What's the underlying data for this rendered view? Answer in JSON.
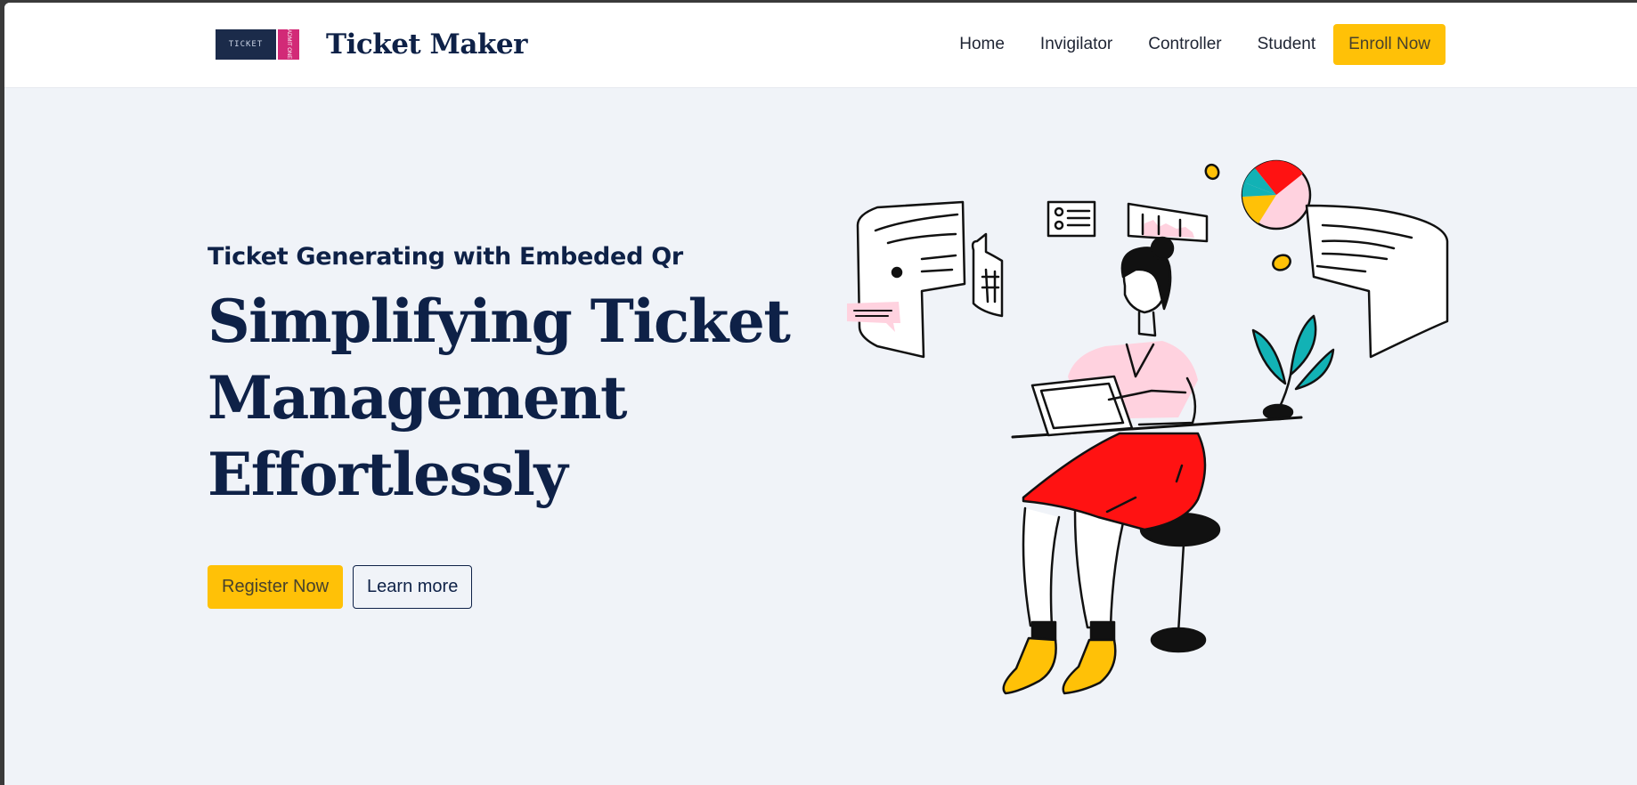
{
  "brand": {
    "name": "Ticket Maker",
    "logo_text": "TICKET",
    "logo_stub_text": "ADMIT ONE"
  },
  "nav": {
    "items": [
      {
        "label": "Home"
      },
      {
        "label": "Invigilator"
      },
      {
        "label": "Controller"
      },
      {
        "label": "Student"
      }
    ],
    "cta_label": "Enroll Now"
  },
  "hero": {
    "eyebrow": "Ticket Generating with Embeded Qr",
    "headline_lines": [
      "Simplifying Ticket",
      "Management",
      "Effortlessly"
    ],
    "primary_button": "Register Now",
    "secondary_button": "Learn more"
  },
  "colors": {
    "accent": "#ffc107",
    "navy": "#0e2147",
    "background": "#f0f3f8",
    "illustration_red": "#ff1212",
    "illustration_pink": "#ffd2df",
    "illustration_teal": "#12b2b5"
  },
  "icons": {
    "logo": "ticket-logo-icon",
    "illustration": "woman-working-on-laptop-illustration"
  }
}
